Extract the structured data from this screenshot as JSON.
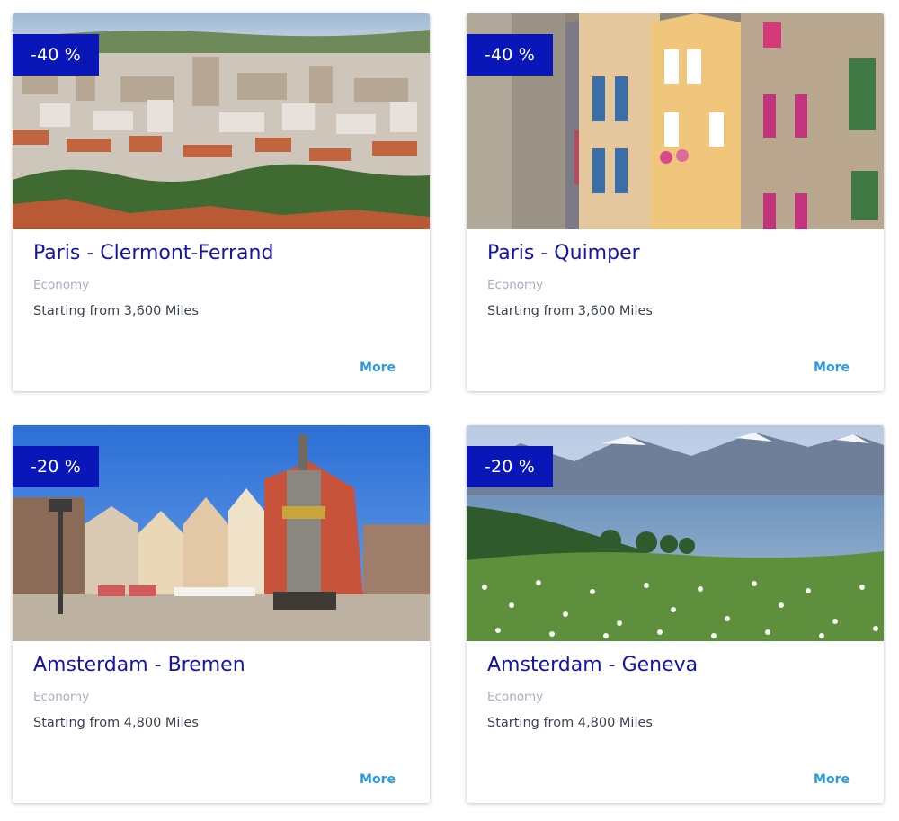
{
  "cards": [
    {
      "discount": "-40 %",
      "route": "Paris - Clermont-Ferrand",
      "cabin": "Economy",
      "price": "Starting from 3,600 Miles",
      "more": "More"
    },
    {
      "discount": "-40 %",
      "route": "Paris - Quimper",
      "cabin": "Economy",
      "price": "Starting from 3,600 Miles",
      "more": "More"
    },
    {
      "discount": "-20 %",
      "route": "Amsterdam - Bremen",
      "cabin": "Economy",
      "price": "Starting from 4,800 Miles",
      "more": "More"
    },
    {
      "discount": "-20 %",
      "route": "Amsterdam - Geneva",
      "cabin": "Economy",
      "price": "Starting from 4,800 Miles",
      "more": "More"
    }
  ],
  "colors": {
    "badge": "#0a17b8",
    "route_title": "#1414a8",
    "cabin_text": "#a6adc2",
    "price_text": "#3a4150",
    "more_link": "#2a9be0"
  }
}
